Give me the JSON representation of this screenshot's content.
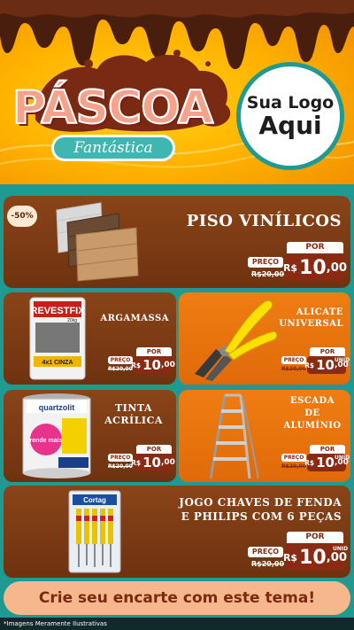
{
  "header": {
    "title": "PÁSCOA",
    "subtitle": "Fantástica",
    "logo_line1": "Sua Logo",
    "logo_line2": "Aqui"
  },
  "featured": {
    "discount": "-50%",
    "title": "PISO VINÍLICOS",
    "por": "POR",
    "preco": "PREÇO",
    "old_price": "R$20,00",
    "currency": "R$",
    "price_int": "10",
    "price_dec": ",00"
  },
  "products": [
    {
      "title": "ARGAMASSA",
      "por": "POR",
      "preco": "PREÇO",
      "old_price": "R$20,00",
      "currency": "R$",
      "price_int": "10",
      "price_dec": ",00",
      "brand": "REVESTFIX",
      "brand_sub": "4x1 CINZA",
      "weight": "20kg"
    },
    {
      "title": "ALICATE UNIVERSAL",
      "por": "POR",
      "preco": "PREÇO",
      "old_price": "R$20,00",
      "currency": "R$",
      "price_int": "10",
      "price_dec": ",00",
      "unit": "UNID"
    },
    {
      "title": "TINTA ACRÍLICA",
      "por": "POR",
      "preco": "PREÇO",
      "old_price": "R$20,00",
      "currency": "R$",
      "price_int": "10",
      "price_dec": ",00",
      "brand": "quartzolit",
      "brand_sub": "rende mais"
    },
    {
      "title": "ESCADA DE ALUMÍNIO",
      "por": "POR",
      "preco": "PREÇO",
      "old_price": "R$20,00",
      "currency": "R$",
      "price_int": "10",
      "price_dec": ",00",
      "unit": "UNID"
    },
    {
      "title_line1": "JOGO CHAVES DE FENDA",
      "title_line2": "E PHILIPS COM 6 PEÇAS",
      "por": "POR",
      "preco": "PREÇO",
      "old_price": "R$20,00",
      "currency": "R$",
      "price_int": "10",
      "price_dec": ",00",
      "unit": "UNID",
      "brand": "Cortag"
    }
  ],
  "cta": "Crie seu encarte com este tema!",
  "footnote": "*Imagens Meramente Ilustrativas",
  "colors": {
    "teal": "#1f9a93",
    "brown": "#7a3a14",
    "orange": "#e8760e",
    "price_red": "#8a2a12",
    "cta_bg": "#f7b78d"
  }
}
